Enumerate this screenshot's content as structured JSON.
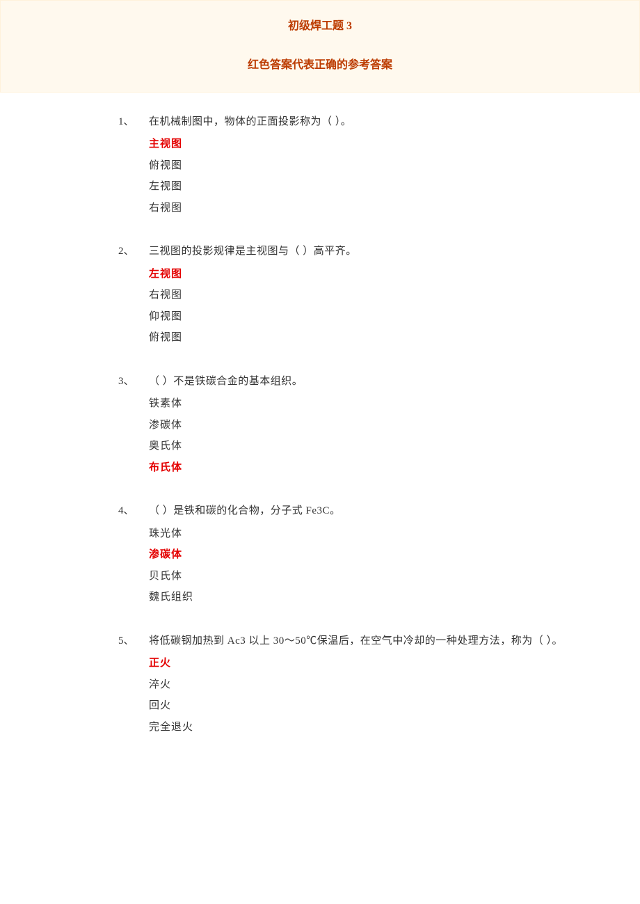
{
  "header": {
    "title": "初级焊工题 3",
    "subtitle": "红色答案代表正确的参考答案"
  },
  "questions": [
    {
      "num": "1、",
      "text": "在机械制图中，物体的正面投影称为（  ）。",
      "options": [
        {
          "text": "主视图",
          "correct": true
        },
        {
          "text": "俯视图",
          "correct": false
        },
        {
          "text": "左视图",
          "correct": false
        },
        {
          "text": "右视图",
          "correct": false
        }
      ]
    },
    {
      "num": "2、",
      "text": "三视图的投影规律是主视图与（  ）高平齐。",
      "options": [
        {
          "text": "左视图",
          "correct": true
        },
        {
          "text": "右视图",
          "correct": false
        },
        {
          "text": "仰视图",
          "correct": false
        },
        {
          "text": "俯视图",
          "correct": false
        }
      ]
    },
    {
      "num": "3、",
      "text": "（  ）不是铁碳合金的基本组织。",
      "options": [
        {
          "text": "铁素体",
          "correct": false
        },
        {
          "text": "渗碳体",
          "correct": false
        },
        {
          "text": "奥氏体",
          "correct": false
        },
        {
          "text": "布氏体",
          "correct": true
        }
      ]
    },
    {
      "num": "4、",
      "text": "（  ）是铁和碳的化合物，分子式 Fe3C。",
      "options": [
        {
          "text": "珠光体",
          "correct": false
        },
        {
          "text": "渗碳体",
          "correct": true
        },
        {
          "text": "贝氏体",
          "correct": false
        },
        {
          "text": "魏氏组织",
          "correct": false
        }
      ]
    },
    {
      "num": "5、",
      "text": "将低碳钢加热到 Ac3 以上 30～50℃保温后，在空气中冷却的一种处理方法，称为（  ）。",
      "options": [
        {
          "text": "正火",
          "correct": true
        },
        {
          "text": "淬火",
          "correct": false
        },
        {
          "text": "回火",
          "correct": false
        },
        {
          "text": "完全退火",
          "correct": false
        }
      ]
    }
  ]
}
